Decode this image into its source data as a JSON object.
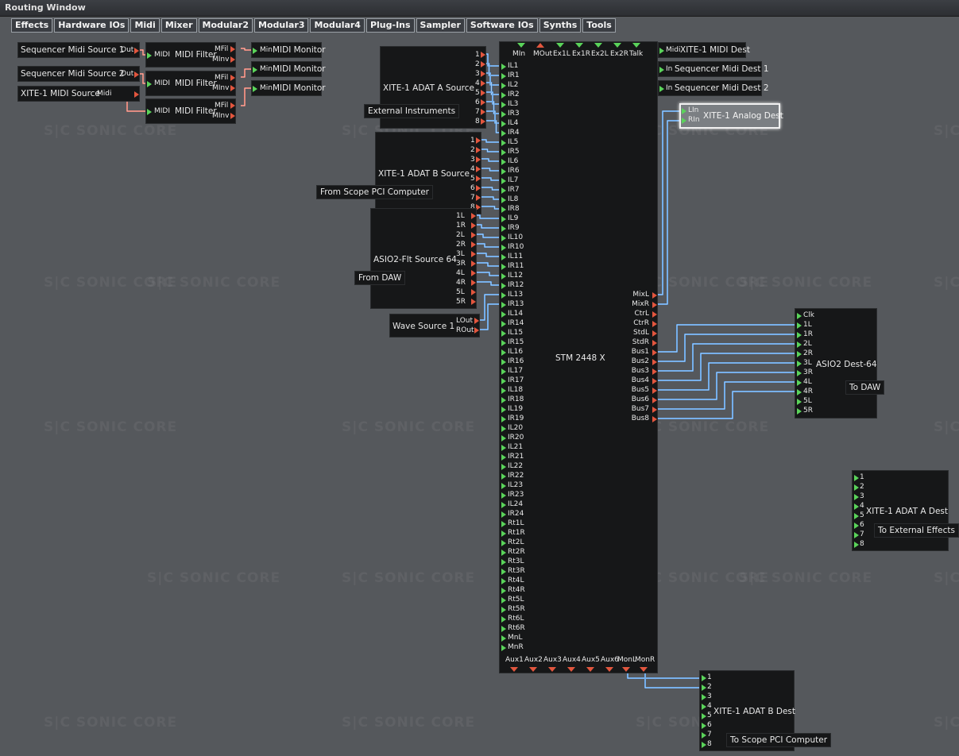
{
  "window": {
    "title": "Routing Window"
  },
  "tabs": [
    "Effects",
    "Hardware IOs",
    "Midi",
    "Mixer",
    "Modular2",
    "Modular3",
    "Modular4",
    "Plug-Ins",
    "Sampler",
    "Software IOs",
    "Synths",
    "Tools"
  ],
  "watermark": "S|C  SONIC CORE",
  "modules": {
    "seq_src1": {
      "name": "Sequencer Midi Source 1",
      "out": "Out"
    },
    "seq_src2": {
      "name": "Sequencer Midi Source 2",
      "out": "Out"
    },
    "xite_midi_src": {
      "name": "XITE-1 MIDI Source",
      "out": "Midi"
    },
    "midi_filter": {
      "name": "MIDI Filter",
      "in": "MIDI",
      "out1": "MFil",
      "out2": "MInv"
    },
    "midi_monitor": {
      "name": "MIDI Monitor",
      "in": "Min"
    },
    "adat_a_src": {
      "name": "XITE-1 ADAT A Source",
      "tag": "External Instruments"
    },
    "adat_b_src": {
      "name": "XITE-1 ADAT B Source",
      "tag": "From Scope PCI Computer"
    },
    "asio_src": {
      "name": "ASIO2-Flt Source 64",
      "tag": "From DAW",
      "ports": [
        "1L",
        "1R",
        "2L",
        "2R",
        "3L",
        "3R",
        "4L",
        "4R",
        "5L",
        "5R"
      ]
    },
    "wave_src": {
      "name": "Wave Source 1",
      "ports": [
        "LOut",
        "ROut"
      ]
    },
    "stm": {
      "name": "STM 2448 X",
      "top_ports": [
        "MIn",
        "MOut",
        "Ex1L",
        "Ex1R",
        "Ex2L",
        "Ex2R",
        "Talk"
      ],
      "left_ports": [
        "IL1",
        "IR1",
        "IL2",
        "IR2",
        "IL3",
        "IR3",
        "IL4",
        "IR4",
        "IL5",
        "IR5",
        "IL6",
        "IR6",
        "IL7",
        "IR7",
        "IL8",
        "IR8",
        "IL9",
        "IR9",
        "IL10",
        "IR10",
        "IL11",
        "IR11",
        "IL12",
        "IR12",
        "IL13",
        "IR13",
        "IL14",
        "IR14",
        "IL15",
        "IR15",
        "IL16",
        "IR16",
        "IL17",
        "IR17",
        "IL18",
        "IR18",
        "IL19",
        "IR19",
        "IL20",
        "IR20",
        "IL21",
        "IR21",
        "IL22",
        "IR22",
        "IL23",
        "IR23",
        "IL24",
        "IR24",
        "Rt1L",
        "Rt1R",
        "Rt2L",
        "Rt2R",
        "Rt3L",
        "Rt3R",
        "Rt4L",
        "Rt4R",
        "Rt5L",
        "Rt5R",
        "Rt6L",
        "Rt6R",
        "MnL",
        "MnR"
      ],
      "right_ports": [
        "MixL",
        "MixR",
        "CtrL",
        "CtrR",
        "StdL",
        "StdR",
        "Bus1",
        "Bus2",
        "Bus3",
        "Bus4",
        "Bus5",
        "Bus6",
        "Bus7",
        "Bus8"
      ],
      "bottom_ports": [
        "Aux1",
        "Aux2",
        "Aux3",
        "Aux4",
        "Aux5",
        "Aux6",
        "MonL",
        "MonR"
      ]
    },
    "xite_midi_dest": {
      "name": "XITE-1 MIDI Dest",
      "in": "Midi"
    },
    "seq_dest1": {
      "name": "Sequencer Midi Dest 1",
      "in": "In"
    },
    "seq_dest2": {
      "name": "Sequencer Midi Dest 2",
      "in": "In"
    },
    "analog_dest": {
      "name": "XITE-1 Analog Dest",
      "ports": [
        "LIn",
        "RIn"
      ]
    },
    "asio_dest": {
      "name": "ASIO2 Dest-64",
      "tag": "To DAW",
      "ports": [
        "Clk",
        "1L",
        "1R",
        "2L",
        "2R",
        "3L",
        "3R",
        "4L",
        "4R",
        "5L",
        "5R"
      ]
    },
    "adat_a_dest": {
      "name": "XITE-1 ADAT A Dest",
      "tag": "To External Effects"
    },
    "adat_b_dest": {
      "name": "XITE-1 ADAT B Dest",
      "tag": "To Scope PCI Computer"
    }
  },
  "colors": {
    "background": "#55585c",
    "module": "#161718",
    "audio_wire": "#3c8ee6",
    "midi_wire": "#e2563e",
    "port_in": "#5ad35a",
    "port_out": "#e2563e"
  }
}
